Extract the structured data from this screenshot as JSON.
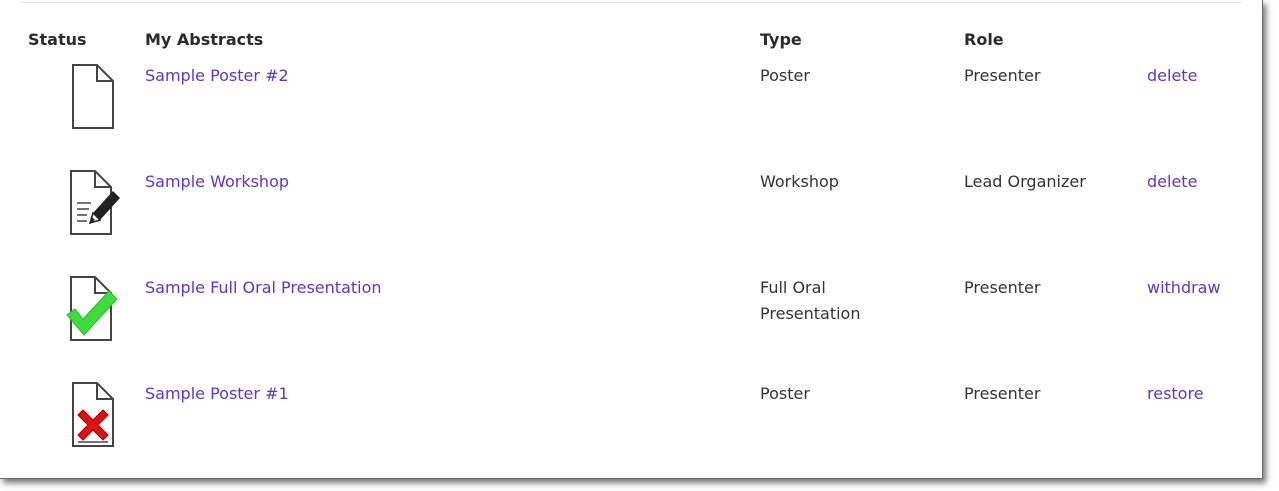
{
  "table": {
    "headers": {
      "status": "Status",
      "title": "My Abstracts",
      "type": "Type",
      "role": "Role"
    },
    "rows": [
      {
        "status_icon": "blank-document-icon",
        "title": "Sample Poster #2",
        "type": "Poster",
        "role": "Presenter",
        "action": "delete"
      },
      {
        "status_icon": "draft-document-pencil-icon",
        "title": "Sample Workshop",
        "type": "Workshop",
        "role": "Lead Organizer",
        "action": "delete"
      },
      {
        "status_icon": "submitted-document-checkmark-icon",
        "title": "Sample Full Oral Presentation",
        "type_line1": "Full Oral",
        "type_line2": "Presentation",
        "role": "Presenter",
        "action": "withdraw"
      },
      {
        "status_icon": "withdrawn-document-x-icon",
        "title": "Sample Poster #1",
        "type": "Poster",
        "role": "Presenter",
        "action": "restore"
      }
    ]
  },
  "colors": {
    "link": "#5b35d5",
    "checkmark": "#3ddc3d",
    "x_mark": "#e01010"
  }
}
